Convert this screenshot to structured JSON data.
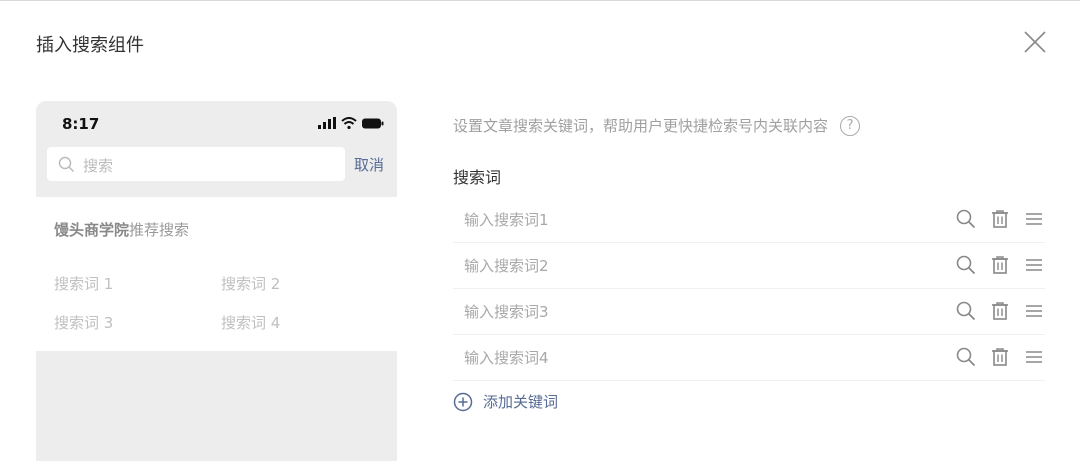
{
  "dialog": {
    "title": "插入搜索组件"
  },
  "phone": {
    "time": "8:17",
    "search_placeholder": "搜索",
    "cancel": "取消",
    "rec_title_bold": "馒头商学院",
    "rec_title_rest": "推荐搜索",
    "rec_items": [
      "搜索词 1",
      "搜索词 2",
      "搜索词 3",
      "搜索词 4"
    ]
  },
  "settings": {
    "hint": "设置文章搜索关键词，帮助用户更快捷检索号内关联内容",
    "help": "?",
    "section_label": "搜索词",
    "keywords": [
      {
        "value": "",
        "placeholder": "输入搜索词1"
      },
      {
        "value": "",
        "placeholder": "输入搜索词2"
      },
      {
        "value": "",
        "placeholder": "输入搜索词3"
      },
      {
        "value": "",
        "placeholder": "输入搜索词4"
      }
    ],
    "add_label": "添加关键词"
  },
  "icons": {
    "close": "close-icon",
    "search": "search-icon",
    "delete": "trash-icon",
    "drag": "drag-handle-icon",
    "add": "plus-circle-icon",
    "help": "question-circle-icon"
  },
  "colors": {
    "link": "#576b95",
    "placeholder": "#a8a8a8",
    "phone_bg": "#ededed"
  }
}
